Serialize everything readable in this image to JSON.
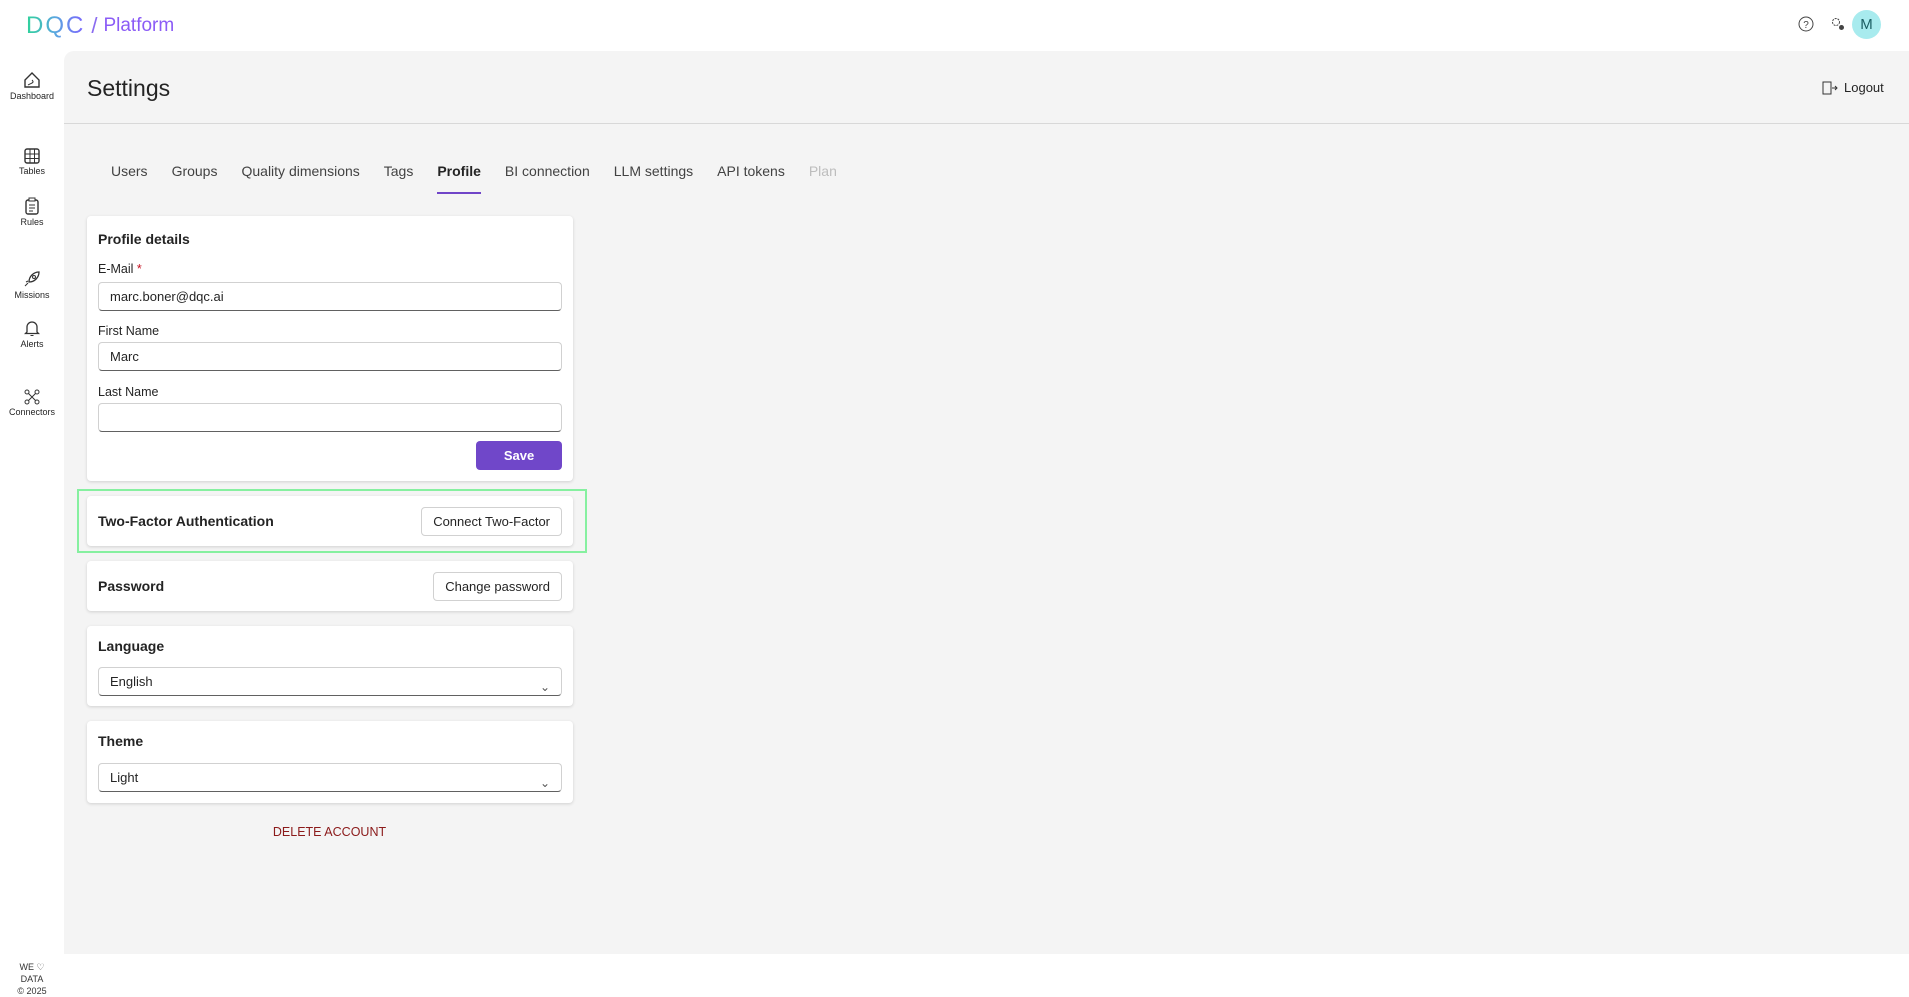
{
  "header": {
    "logo_text": "DQC",
    "logo_separator": "/",
    "product": "Platform",
    "avatar_initial": "M"
  },
  "sidebar": {
    "items": [
      {
        "label": "Dashboard"
      },
      {
        "label": "Tables"
      },
      {
        "label": "Rules"
      },
      {
        "label": "Missions"
      },
      {
        "label": "Alerts"
      },
      {
        "label": "Connectors"
      }
    ],
    "footer": {
      "line1": "WE ♡",
      "line2": "DATA",
      "line3": "© 2025"
    }
  },
  "page": {
    "title": "Settings",
    "logout": "Logout"
  },
  "tabs": [
    {
      "label": "Users"
    },
    {
      "label": "Groups"
    },
    {
      "label": "Quality dimensions"
    },
    {
      "label": "Tags"
    },
    {
      "label": "Profile"
    },
    {
      "label": "BI connection"
    },
    {
      "label": "LLM settings"
    },
    {
      "label": "API tokens"
    },
    {
      "label": "Plan"
    }
  ],
  "profile": {
    "title": "Profile details",
    "email_label": "E-Mail",
    "required_mark": "*",
    "email": "marc.boner@dqc.ai",
    "first_name_label": "First Name",
    "first_name": "Marc",
    "last_name_label": "Last Name",
    "last_name": "",
    "save": "Save"
  },
  "two_factor": {
    "title": "Two-Factor Authentication",
    "button": "Connect Two-Factor"
  },
  "password": {
    "title": "Password",
    "button": "Change password"
  },
  "language": {
    "title": "Language",
    "value": "English"
  },
  "theme": {
    "title": "Theme",
    "value": "Light"
  },
  "delete_account": "DELETE ACCOUNT",
  "colors": {
    "accent": "#7047c9",
    "avatar": "#a8ebee",
    "highlight": "#86f0a0",
    "danger": "#8b1a1a"
  }
}
